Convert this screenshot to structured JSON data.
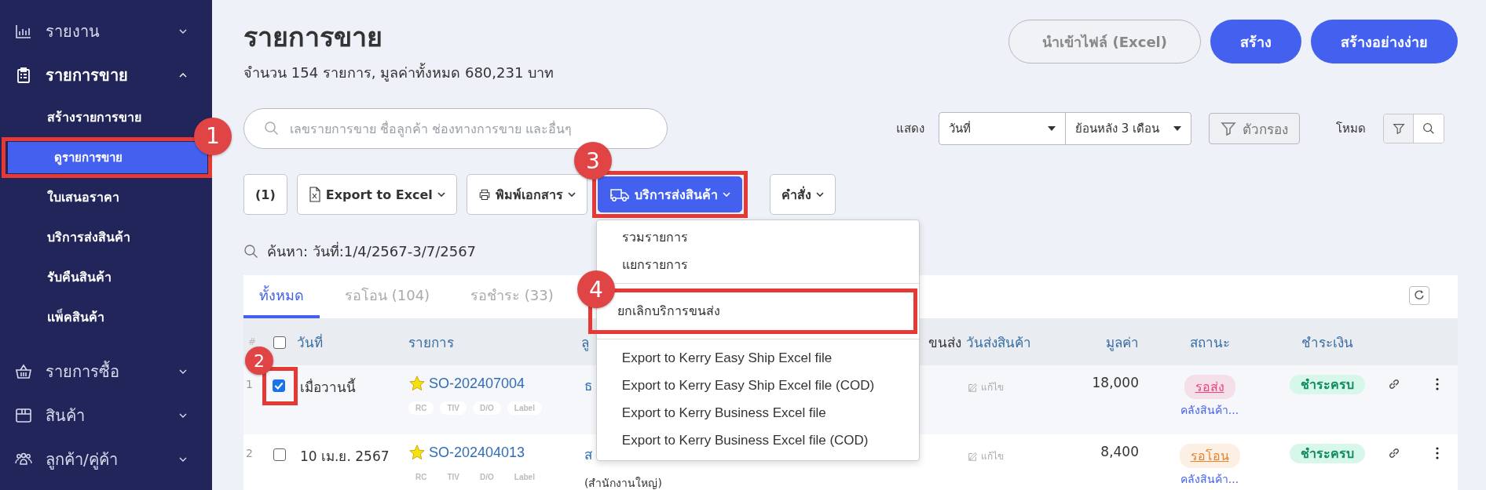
{
  "sidebar": {
    "groups": [
      {
        "label": "รายงาน",
        "expanded": false
      },
      {
        "label": "รายการขาย",
        "expanded": true,
        "children": [
          {
            "label": "สร้างรายการขาย",
            "selected": false
          },
          {
            "label": "ดูรายการขาย",
            "selected": true,
            "step": "1"
          },
          {
            "label": "ใบเสนอราคา",
            "selected": false
          },
          {
            "label": "บริการส่งสินค้า",
            "selected": false
          },
          {
            "label": "รับคืนสินค้า",
            "selected": false
          },
          {
            "label": "แพ็คสินค้า",
            "selected": false
          }
        ]
      },
      {
        "label": "รายการซื้อ",
        "expanded": false
      },
      {
        "label": "สินค้า",
        "expanded": false
      },
      {
        "label": "ลูกค้า/คู่ค้า",
        "expanded": false
      }
    ]
  },
  "header": {
    "title": "รายการขาย",
    "subtitle": "จำนวน 154 รายการ, มูลค่าทั้งหมด 680,231 บาท",
    "buttons": [
      {
        "label": "นำเข้าไฟล์ (Excel)",
        "kind": "outline"
      },
      {
        "label": "สร้าง",
        "kind": "primary"
      },
      {
        "label": "สร้างอย่างง่าย",
        "kind": "primary"
      }
    ]
  },
  "search": {
    "placeholder": "เลขรายการขาย ชื่อลูกค้า ช่องทางการขาย และอื่นๆ"
  },
  "filters": {
    "show_label": "แสดง",
    "selects": [
      "วันที่",
      "ย้อนหลัง 3 เดือน"
    ],
    "filter_button": "ตัวกรอง",
    "mode_label": "โหมด",
    "modes": [
      {
        "selected": true
      },
      {
        "selected": false
      }
    ]
  },
  "toolbar": [
    {
      "label": "(1)",
      "caret": false,
      "kind": "plain"
    },
    {
      "label": "Export to Excel",
      "caret": true,
      "kind": "plain"
    },
    {
      "label": "พิมพ์เอกสาร",
      "caret": true,
      "kind": "plain"
    },
    {
      "label": "บริการส่งสินค้า",
      "caret": true,
      "kind": "active",
      "step": "3",
      "menu": [
        {
          "label": "รวมรายการ",
          "kind": "item"
        },
        {
          "label": "แยกรายการ",
          "kind": "item"
        },
        {
          "kind": "divider"
        },
        {
          "label": "ยกเลิกบริการขนส่ง",
          "kind": "item",
          "step": "4"
        },
        {
          "kind": "divider"
        },
        {
          "label": "Export to Kerry Easy Ship Excel file",
          "kind": "item"
        },
        {
          "label": "Export to Kerry Easy Ship Excel file (COD)",
          "kind": "item"
        },
        {
          "label": "Export to Kerry Business Excel file",
          "kind": "item"
        },
        {
          "label": "Export to Kerry Business Excel file (COD)",
          "kind": "item"
        }
      ]
    },
    {
      "label": "คำสั่ง",
      "caret": true,
      "kind": "plain"
    }
  ],
  "search_summary": "ค้นหา: วันที่:1/4/2567-3/7/2567",
  "tabs": [
    {
      "label": "ทั้งหมด",
      "selected": true
    },
    {
      "label": "รอโอน (104)",
      "selected": false
    },
    {
      "label": "รอชำระ (33)",
      "selected": false
    }
  ],
  "table": {
    "columns": [
      "#",
      "วันที่",
      "รายการ",
      "ลู",
      "ขนส่ง",
      "วันส่งสินค้า",
      "มูลค่า",
      "สถานะ",
      "ชำระเงิน"
    ],
    "header_checked": false,
    "rows": [
      {
        "index": "1",
        "checked": true,
        "step": "2",
        "date": "เมื่อวานนี้",
        "number": "SO-202407004",
        "tags": [
          "RC",
          "TIV",
          "D/O",
          "Label"
        ],
        "customer": "ธ",
        "ship_date": "แก้ไข",
        "value": "18,000",
        "status": {
          "label": "รอส่ง",
          "color": "#e8457f"
        },
        "warehouse": "คลังสินค้า...",
        "payment": "ชำระครบ"
      },
      {
        "index": "2",
        "checked": false,
        "date": "10 เม.ย. 2567",
        "number": "SO-202404013",
        "tags": [
          "RC",
          "TIV",
          "D/O",
          "Label"
        ],
        "customer": "ส",
        "customer_note": "(สำนักงานใหญ่)",
        "ship_date": "แก้ไข",
        "value": "8,400",
        "status": {
          "label": "รอโอน",
          "color": "#e8842e"
        },
        "warehouse": "คลังสินค้า...",
        "payment": "ชำระครบ"
      }
    ]
  }
}
